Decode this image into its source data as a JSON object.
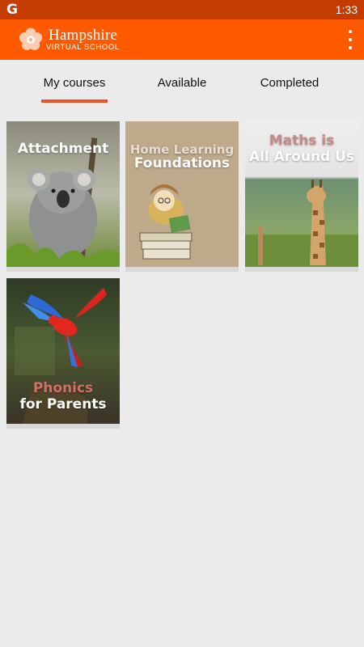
{
  "status_bar": {
    "app_glyph": "G",
    "time": "1:33"
  },
  "app_bar": {
    "brand_title": "Hampshire",
    "brand_subtitle": "VIRTUAL  SCHOOL",
    "logo_icon": "flower-logo-icon",
    "menu_icon": "more-vertical-icon"
  },
  "tabs": [
    {
      "label": "My courses",
      "active": true
    },
    {
      "label": "Available",
      "active": false
    },
    {
      "label": "Completed",
      "active": false
    }
  ],
  "courses": [
    {
      "title_line1": "Attachment",
      "title_line2": ""
    },
    {
      "title_line1": "Home Learning",
      "title_line2": "Foundations"
    },
    {
      "title_line1": "Maths is",
      "title_line2": "All Around Us"
    },
    {
      "title_line1": "Phonics",
      "title_line2": "for Parents"
    }
  ],
  "colors": {
    "status_bar": "#c43c00",
    "app_bar": "#ff5a00",
    "tab_indicator": "#f04e23",
    "background": "#ebebeb"
  }
}
